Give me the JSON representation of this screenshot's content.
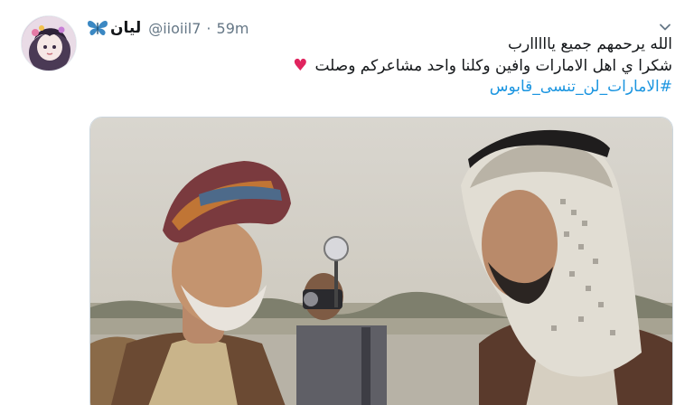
{
  "user": {
    "display_name": "ليان",
    "handle": "@iioiil7",
    "separator": "·",
    "time": "59m"
  },
  "tweet": {
    "lines": [
      "الله يرحمهم جميع يااااارب",
      "شكرا ي اهل الامارات وافين وكلنا واحد مشاعركم وصلت",
      "#الامارات_لن_تنسى_قابوس"
    ],
    "heart": "♥"
  },
  "icons": {
    "more": "chevron-down-icon",
    "name_emoji": "butterfly-icon"
  },
  "colors": {
    "link": "#1b95e0",
    "heart": "#e0245e",
    "butterfly": "#3b88c3",
    "secondary_text": "#657786"
  }
}
